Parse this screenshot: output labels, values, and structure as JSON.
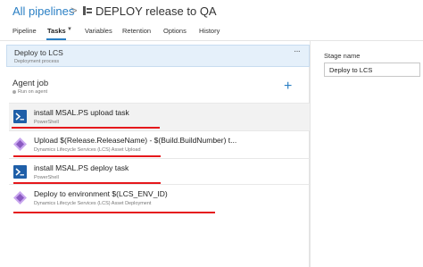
{
  "breadcrumb": {
    "all_pipelines": "All pipelines",
    "separator": ">"
  },
  "pipeline": {
    "title": "DEPLOY release to QA",
    "icon": "release-pipeline-icon"
  },
  "tabs": [
    {
      "label": "Pipeline",
      "active": false
    },
    {
      "label": "Tasks",
      "active": true
    },
    {
      "label": "Variables",
      "active": false
    },
    {
      "label": "Retention",
      "active": false
    },
    {
      "label": "Options",
      "active": false
    },
    {
      "label": "History",
      "active": false
    }
  ],
  "stage": {
    "title": "Deploy to LCS",
    "subtitle": "Deployment process",
    "menu": "···"
  },
  "agent_job": {
    "title": "Agent job",
    "subtitle": "Run on agent",
    "add": "+"
  },
  "tasks": [
    {
      "title": "install MSAL.PS upload task",
      "subtitle": "PowerShell",
      "icon": "powershell-icon",
      "selected": true
    },
    {
      "title": "Upload $(Release.ReleaseName) - $(Build.BuildNumber) t...",
      "subtitle": "Dynamics Lifecycle Services (LCS) Asset Upload",
      "icon": "lcs-icon",
      "selected": false
    },
    {
      "title": "install MSAL.PS deploy task",
      "subtitle": "PowerShell",
      "icon": "powershell-icon",
      "selected": false
    },
    {
      "title": "Deploy to environment $(LCS_ENV_ID)",
      "subtitle": "Dynamics Lifecycle Services (LCS) Asset Deployment",
      "icon": "lcs-icon",
      "selected": false
    }
  ],
  "properties": {
    "stage_name_label": "Stage name",
    "stage_name_value": "Deploy to LCS"
  },
  "colors": {
    "accent": "#2a7fc4",
    "annotation_red": "#e5181c",
    "powershell": "#1f5fa8",
    "lcs": "#8a5ac2"
  }
}
